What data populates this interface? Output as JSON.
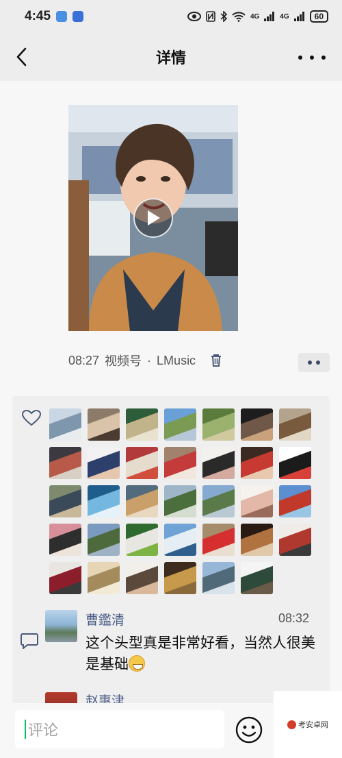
{
  "status_bar": {
    "time": "4:45",
    "network": "4G",
    "network2": "4G",
    "battery": "60"
  },
  "nav": {
    "title": "详情"
  },
  "post": {
    "duration": "08:27",
    "source": "视频号",
    "separator": "·",
    "author": "LMusic"
  },
  "likes": {
    "avatars": [
      {
        "colors": [
          "#c9d6e3",
          "#7f97ad",
          "#e9ecef"
        ]
      },
      {
        "colors": [
          "#8d7b6a",
          "#d9c3a9",
          "#4b3b30"
        ]
      },
      {
        "colors": [
          "#2e5d3a",
          "#c2b48a",
          "#e8e2cf"
        ]
      },
      {
        "colors": [
          "#6aa0d8",
          "#7a9b54",
          "#b7c7d8"
        ]
      },
      {
        "colors": [
          "#5a7b3c",
          "#9bb26e",
          "#d0c9a0"
        ]
      },
      {
        "colors": [
          "#1d1d1d",
          "#6f5848",
          "#c9a27c"
        ]
      },
      {
        "colors": [
          "#b5a48d",
          "#7a5a3d",
          "#e2d7c5"
        ]
      },
      {
        "colors": [
          "#3c3a40",
          "#b85a4a",
          "#d8cfc5"
        ]
      },
      {
        "colors": [
          "#f2f2f2",
          "#2d3f6b",
          "#e4c7ac"
        ]
      },
      {
        "colors": [
          "#b23a3a",
          "#e5dccd",
          "#d14e3c"
        ]
      },
      {
        "colors": [
          "#a0826d",
          "#c43b3b",
          "#f1e7dc"
        ]
      },
      {
        "colors": [
          "#f3f1ee",
          "#2a2a2a",
          "#d3a9a0"
        ]
      },
      {
        "colors": [
          "#3a2a22",
          "#c63a31",
          "#e8c9b0"
        ]
      },
      {
        "colors": [
          "#ffffff",
          "#1b1b1b",
          "#d8403a"
        ]
      },
      {
        "colors": [
          "#7d8a6d",
          "#3a4a58",
          "#c9b79a"
        ]
      },
      {
        "colors": [
          "#1f5e8c",
          "#74b8e0",
          "#e6f2fa"
        ]
      },
      {
        "colors": [
          "#526b7d",
          "#c99f6a",
          "#e8d8c0"
        ]
      },
      {
        "colors": [
          "#9fb6c8",
          "#4b6e3d",
          "#d3ddd0"
        ]
      },
      {
        "colors": [
          "#86a9cf",
          "#5b7a4a",
          "#b9c9d4"
        ]
      },
      {
        "colors": [
          "#f5f2ee",
          "#e3b8a8",
          "#9a6b5a"
        ]
      },
      {
        "colors": [
          "#5b8fd0",
          "#c0392b",
          "#9ac6e6"
        ]
      },
      {
        "colors": [
          "#d88f9a",
          "#2e2e2e",
          "#ede4dc"
        ]
      },
      {
        "colors": [
          "#7a9ac0",
          "#4d6a3c",
          "#9db2c2"
        ]
      },
      {
        "colors": [
          "#2f6b2f",
          "#e8e6e0",
          "#7cb342"
        ]
      },
      {
        "colors": [
          "#6fa3d6",
          "#e6eef5",
          "#2f5f8c"
        ]
      },
      {
        "colors": [
          "#a58c6b",
          "#d5302f",
          "#e9ded0"
        ]
      },
      {
        "colors": [
          "#2a1a14",
          "#b07340",
          "#e0c8a8"
        ]
      },
      {
        "colors": [
          "#f0ebe6",
          "#b0392f",
          "#3a3a3a"
        ]
      },
      {
        "colors": [
          "#e9e6e1",
          "#8c1d2b",
          "#3a3a3a"
        ]
      },
      {
        "colors": [
          "#e6d6b5",
          "#a48b5c",
          "#f3ead6"
        ]
      },
      {
        "colors": [
          "#f2efe9",
          "#5b4a3c",
          "#d9b89c"
        ]
      },
      {
        "colors": [
          "#3d2b1e",
          "#c69a4a",
          "#8a6a3a"
        ]
      },
      {
        "colors": [
          "#97b7d8",
          "#506a7a",
          "#d9e3ec"
        ]
      },
      {
        "colors": [
          "#f4f4f4",
          "#2d4a3a",
          "#6a5a48"
        ]
      }
    ]
  },
  "comments": [
    {
      "name": "曹鑑清",
      "time": "08:32",
      "text": "这个头型真是非常好看，当然人很美是基础"
    },
    {
      "name": "赵惠津"
    }
  ],
  "input": {
    "placeholder": "评论"
  },
  "watermark": {
    "text": "考安卓网"
  }
}
